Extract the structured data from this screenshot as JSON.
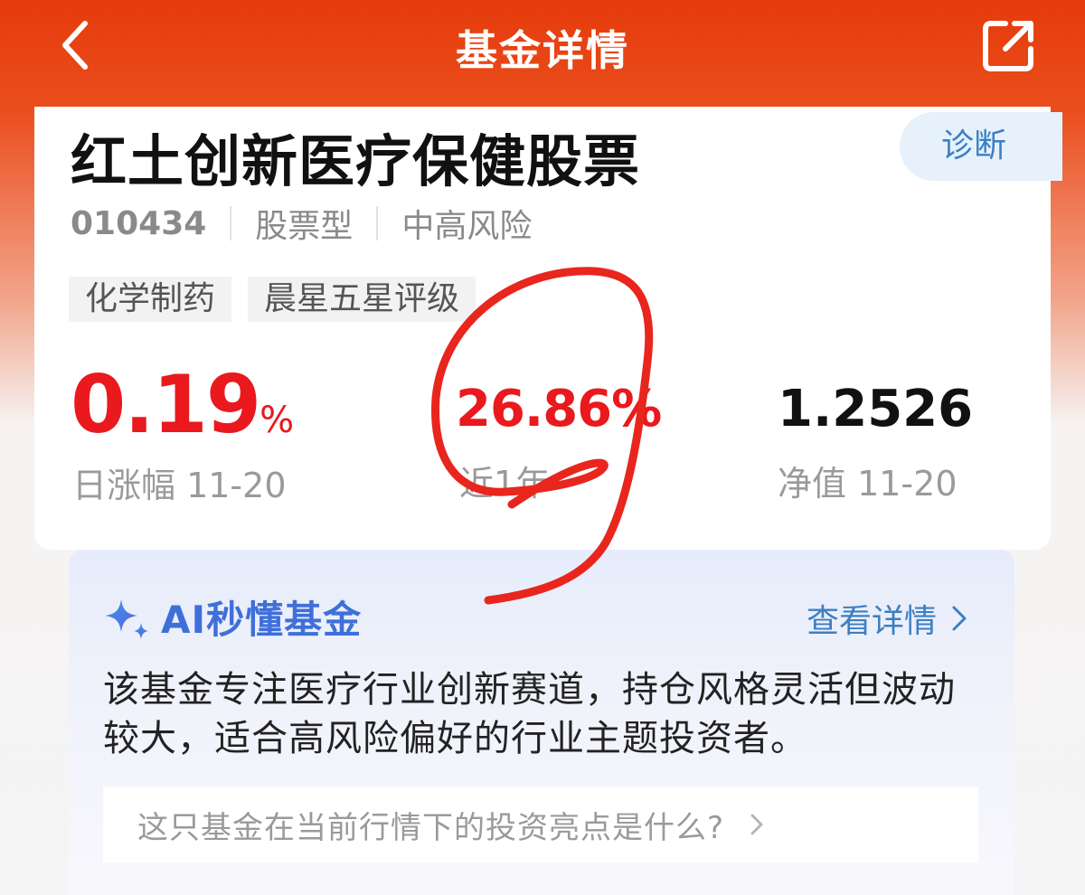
{
  "header": {
    "title": "基金详情"
  },
  "fund": {
    "name": "红土创新医疗保健股票",
    "diagnose_label": "诊断",
    "code": "010434",
    "type": "股票型",
    "risk": "中高风险",
    "tags": [
      "化学制药",
      "晨星五星评级"
    ]
  },
  "stats": {
    "daily_change": {
      "value": "0.19",
      "unit": "%",
      "label": "日涨幅 11-20"
    },
    "one_year": {
      "value": "26.86%",
      "label": "近1年"
    },
    "nav": {
      "value": "1.2526",
      "label": "净值 11-20"
    }
  },
  "ai": {
    "title": "AI秒懂基金",
    "more_label": "查看详情",
    "summary": "该基金专注医疗行业创新赛道，持仓风格灵活但波动较大，适合高风险偏好的行业主题投资者。",
    "question": "这只基金在当前行情下的投资亮点是什么?"
  },
  "colors": {
    "header": "#e63b0c",
    "rise": "#e9191d",
    "link": "#3d7fc2",
    "ai_title": "#3f6fd9",
    "annotation": "#e8261d"
  },
  "icons": {
    "back": "chevron-left-icon",
    "share": "share-icon",
    "ai": "sparkle-icon",
    "more": "chevron-right-icon"
  }
}
